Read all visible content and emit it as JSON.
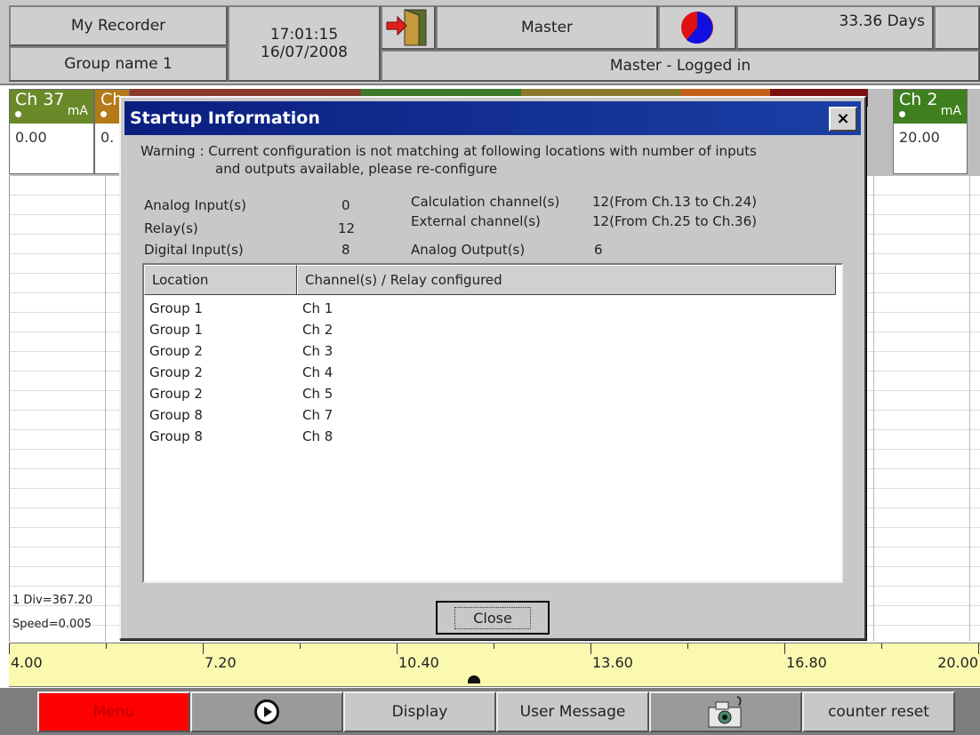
{
  "header": {
    "recorder_name": "My Recorder",
    "group_name": "Group name 1",
    "time": "17:01:15",
    "date": "16/07/2008",
    "user": "Master",
    "days_remaining": "33.36 Days",
    "login_status": "Master - Logged in"
  },
  "channels": {
    "left_tile": {
      "label": "Ch 37",
      "unit": "mA",
      "value": "0.00",
      "color": "#6a8a2a"
    },
    "second_tile": {
      "label": "Ch",
      "value": "0.",
      "color": "#b57a18"
    },
    "right_tile": {
      "label": "Ch 2",
      "unit": "mA",
      "value": "20.00",
      "color": "#3f7f1f"
    }
  },
  "trend": {
    "div_label": "1 Div=367.20",
    "speed_label": "Speed=0.005"
  },
  "scale": {
    "labels": [
      "4.00",
      "7.20",
      "10.40",
      "13.60",
      "16.80",
      "20.00"
    ],
    "min": 4.0,
    "max": 20.0
  },
  "toolbar": {
    "menu": "Menu",
    "play_icon": "play-icon",
    "display": "Display",
    "user_message": "User Message",
    "camera_icon": "camera-icon",
    "counter_reset": "counter reset"
  },
  "dialog": {
    "title": "Startup Information",
    "close_x": "×",
    "warning_line1": "Warning : Current configuration is not matching at following locations with number of inputs",
    "warning_line2": "and outputs available, please re-configure",
    "info": {
      "analog_input_label": "Analog Input(s)",
      "analog_input_value": "0",
      "relay_label": "Relay(s)",
      "relay_value": "12",
      "digital_input_label": "Digital Input(s)",
      "digital_input_value": "8",
      "calc_label": "Calculation channel(s)",
      "calc_value": "12(From Ch.13 to Ch.24)",
      "external_label": "External channel(s)",
      "external_value": "12(From Ch.25 to Ch.36)",
      "analog_output_label": "Analog Output(s)",
      "analog_output_value": "6"
    },
    "list_headers": {
      "location": "Location",
      "channels": "Channel(s) / Relay configured"
    },
    "rows": [
      {
        "location": "Group 1",
        "channel": "Ch 1"
      },
      {
        "location": "Group 1",
        "channel": "Ch 2"
      },
      {
        "location": "Group 2",
        "channel": "Ch 3"
      },
      {
        "location": "Group 2",
        "channel": "Ch 4"
      },
      {
        "location": "Group 2",
        "channel": "Ch 5"
      },
      {
        "location": "Group 8",
        "channel": "Ch 7"
      },
      {
        "location": "Group 8",
        "channel": "Ch 8"
      }
    ],
    "close_button": "Close"
  },
  "colors": {
    "title_bar": "#0a1e7e",
    "menu_button": "#ff0000",
    "scale_background": "#fbf8b0"
  }
}
